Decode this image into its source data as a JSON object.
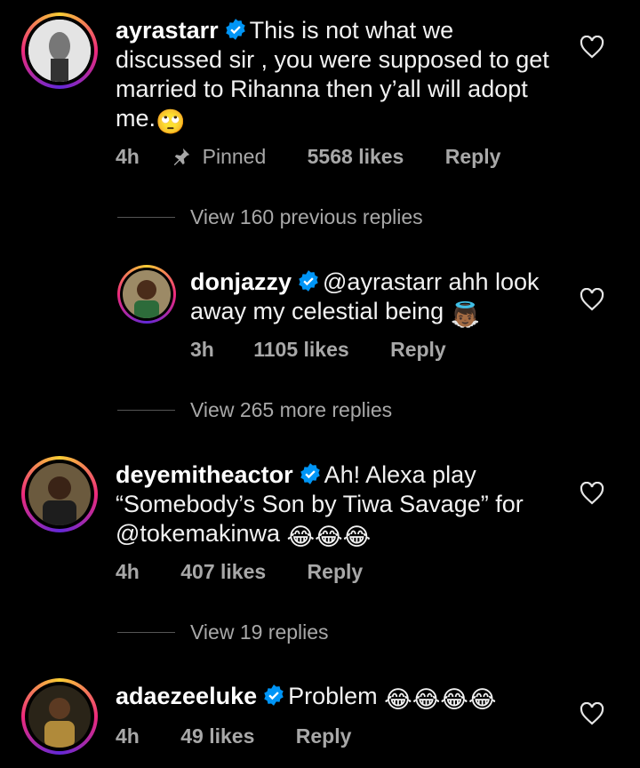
{
  "comments": [
    {
      "username": "ayrastarr",
      "text": "This is not what we discussed sir , you  were supposed to get married to Rihanna then y’all will adopt me.",
      "emoji": "🙄",
      "time": "4h",
      "pinned_label": "Pinned",
      "likes": "5568 likes",
      "reply": "Reply"
    },
    {
      "username": "donjazzy",
      "text": "@ayrastarr ahh look away my celestial being",
      "emoji": "👼🏾",
      "time": "3h",
      "likes": "1105 likes",
      "reply": "Reply"
    },
    {
      "username": "deyemitheactor",
      "text_line1": "Ah! Alexa play",
      "text_line2": "“Somebody’s Son by Tiwa Savage” for",
      "text_line3": "@tokemakinwa",
      "emoji": "😂😂😂",
      "time": "4h",
      "likes": "407 likes",
      "reply": "Reply"
    },
    {
      "username": "adaezeeluke",
      "text": "Problem",
      "emoji": "😂😂😂😂",
      "time": "4h",
      "likes": "49 likes",
      "reply": "Reply"
    }
  ],
  "threads": {
    "view_previous_1": "View 160 previous replies",
    "view_more_1": "View 265 more replies",
    "view_replies_3": "View 19 replies"
  },
  "colors": {
    "background": "#000000",
    "verified": "#0095f6",
    "meta_text": "#a8a8a8"
  }
}
